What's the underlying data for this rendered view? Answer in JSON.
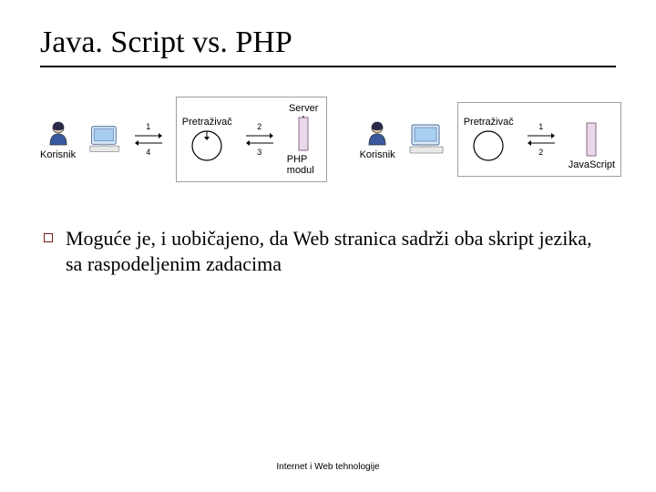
{
  "title": "Java. Script vs. PHP",
  "left": {
    "userLabel": "Korisnik",
    "browserLabel": "Pretraživač",
    "serverLabel": "Server",
    "moduleLabel": "PHP modul",
    "steps": {
      "a": "1",
      "b": "2",
      "c": "3",
      "d": "4"
    }
  },
  "right": {
    "userLabel": "Korisnik",
    "browserLabel": "Pretraživač",
    "moduleLabel": "JavaScript",
    "steps": {
      "a": "1",
      "b": "2"
    }
  },
  "bullet": "Moguće je, i uobičajeno, da Web stranica sadrži oba skript jezika, sa raspodeljenim zadacima",
  "footer": "Internet i Web tehnologije"
}
